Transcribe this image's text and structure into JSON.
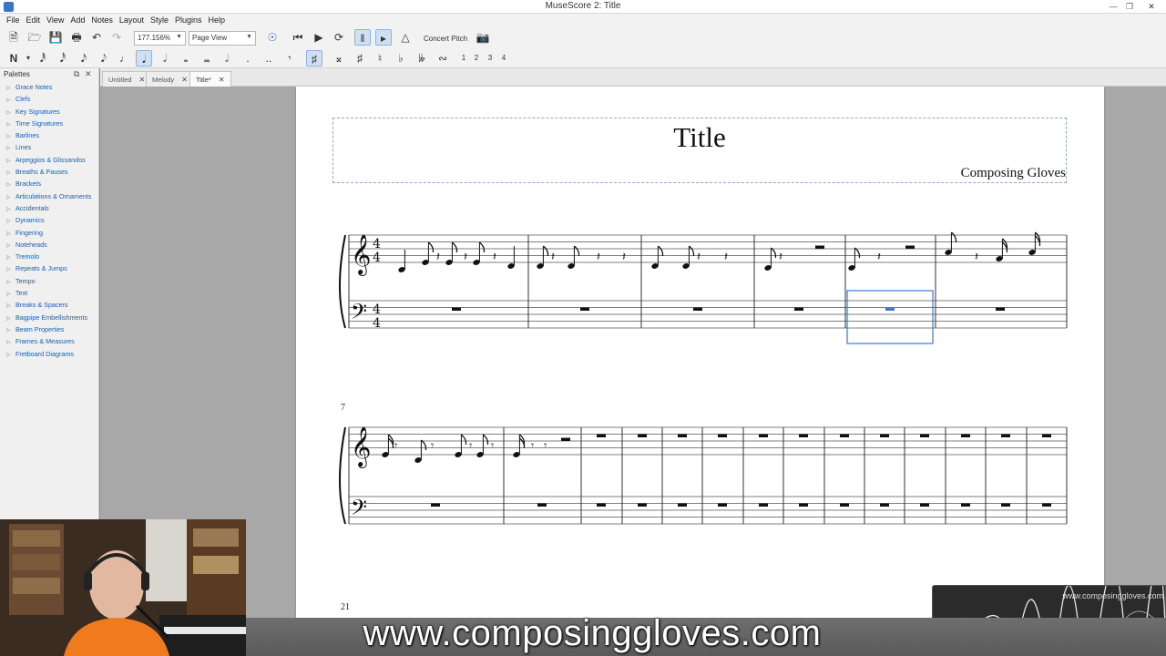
{
  "window": {
    "title": "MuseScore 2: Title"
  },
  "menu": [
    "File",
    "Edit",
    "View",
    "Add",
    "Notes",
    "Layout",
    "Style",
    "Plugins",
    "Help"
  ],
  "toolbar": {
    "zoom_value": "177.156%",
    "view_mode": "Page View",
    "concert_pitch_label": "Concert Pitch",
    "voices": [
      "1",
      "2",
      "3",
      "4"
    ]
  },
  "palette": {
    "title": "Palettes",
    "items": [
      "Grace Notes",
      "Clefs",
      "Key Signatures",
      "Time Signatures",
      "Barlines",
      "Lines",
      "Arpeggios & Glissandos",
      "Breaths & Pauses",
      "Brackets",
      "Articulations & Ornaments",
      "Accidentals",
      "Dynamics",
      "Fingering",
      "Noteheads",
      "Tremolo",
      "Repeats & Jumps",
      "Tempo",
      "Text",
      "Breaks & Spacers",
      "Bagpipe Embellishments",
      "Beam Properties",
      "Frames & Measures",
      "Fretboard Diagrams"
    ]
  },
  "tabs": [
    {
      "label": "Untitled",
      "active": false
    },
    {
      "label": "Melody",
      "active": false
    },
    {
      "label": "Title*",
      "active": true
    }
  ],
  "score": {
    "title": "Title",
    "composer": "Composing Gloves",
    "time_signature": "4/4",
    "system2_measure_number": "7",
    "system3_measure_number": "21"
  },
  "overlay": {
    "banner": "www.composinggloves.com",
    "wave_url": "www.composinggloves.com"
  },
  "colors": {
    "selection": "#3a78d6",
    "link_blue": "#1a5fb4",
    "frame_border": "#8aa9d8"
  }
}
